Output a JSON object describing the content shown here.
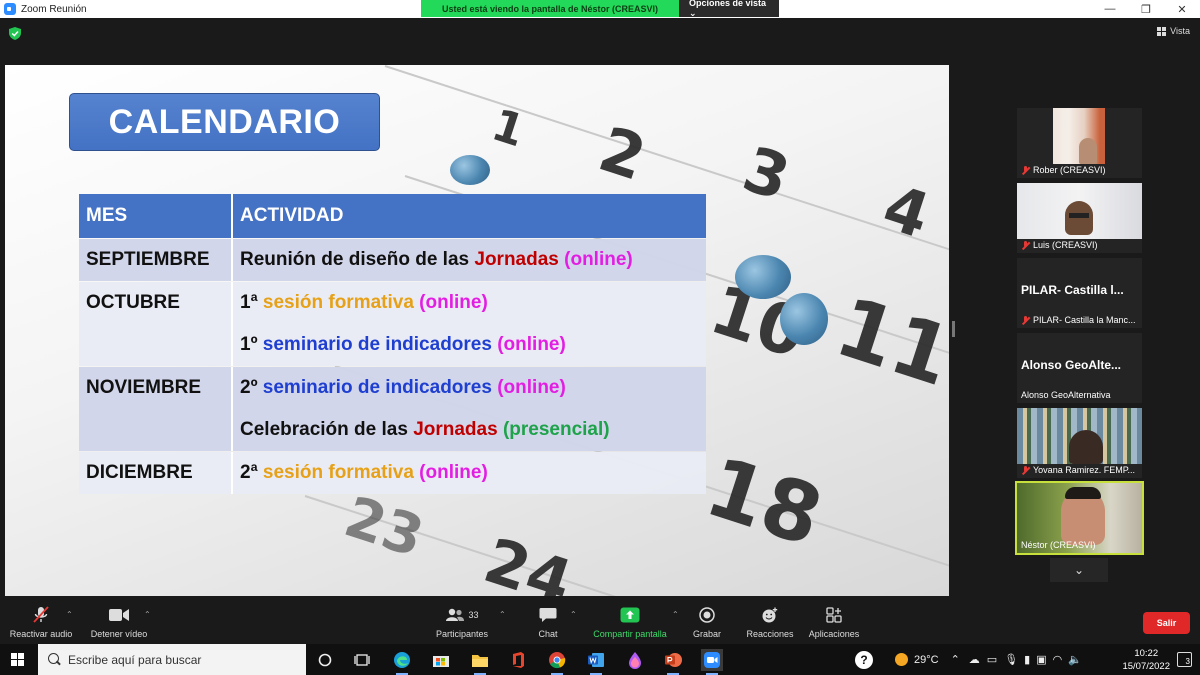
{
  "window": {
    "title": "Zoom Reunión",
    "minimize": "—",
    "maximize": "❐",
    "close": "✕"
  },
  "share_banner": {
    "notice": "Usted está viendo la pantalla de Néstor (CREASVI)",
    "view_options": "Opciones de vista ⌄"
  },
  "view_button": "Vista",
  "slide": {
    "title": "CALENDARIO",
    "background_numbers": [
      "1",
      "2",
      "3",
      "4",
      "10",
      "11",
      "18",
      "23",
      "24"
    ],
    "headers": [
      "MES",
      "ACTIVIDAD"
    ],
    "rows": [
      {
        "month": "SEPTIEMBRE",
        "activities": [
          [
            {
              "t": "Reunión de diseño de las ",
              "c": "k"
            },
            {
              "t": "Jornadas",
              "c": "red"
            },
            {
              "t": " (online)",
              "c": "mag"
            }
          ]
        ]
      },
      {
        "month": "OCTUBRE",
        "activities": [
          [
            {
              "t": "1ª ",
              "c": "k"
            },
            {
              "t": "sesión formativa",
              "c": "gold"
            },
            {
              "t": " (online)",
              "c": "mag"
            }
          ],
          [
            {
              "t": "1º ",
              "c": "k"
            },
            {
              "t": "seminario de indicadores",
              "c": "blue"
            },
            {
              "t": " (online)",
              "c": "mag"
            }
          ]
        ]
      },
      {
        "month": "NOVIEMBRE",
        "activities": [
          [
            {
              "t": "2º ",
              "c": "k"
            },
            {
              "t": "seminario de indicadores",
              "c": "blue"
            },
            {
              "t": " (online)",
              "c": "mag"
            }
          ],
          [
            {
              "t": "Celebración de las ",
              "c": "k"
            },
            {
              "t": "Jornadas",
              "c": "red"
            },
            {
              "t": " (presencial)",
              "c": "green"
            }
          ]
        ]
      },
      {
        "month": "DICIEMBRE",
        "activities": [
          [
            {
              "t": "2ª ",
              "c": "k"
            },
            {
              "t": "sesión formativa",
              "c": "gold"
            },
            {
              "t": " (online)",
              "c": "mag"
            }
          ]
        ]
      }
    ]
  },
  "participants": [
    {
      "name": "Rober (CREASVI)",
      "muted": true,
      "video": true,
      "display": ""
    },
    {
      "name": "Luis (CREASVI)",
      "muted": true,
      "video": true,
      "display": ""
    },
    {
      "name": "PILAR- Castilla la Manc...",
      "muted": true,
      "video": false,
      "display": "PILAR-  Castilla  l..."
    },
    {
      "name": "Alonso GeoAlternativa",
      "muted": false,
      "video": false,
      "display": "Alonso  GeoAlte..."
    },
    {
      "name": "Yovana Ramirez. FEMP...",
      "muted": true,
      "video": true,
      "display": ""
    },
    {
      "name": "Néstor (CREASVI)",
      "muted": false,
      "video": true,
      "display": "",
      "active": true
    }
  ],
  "toolbar": {
    "unmute": "Reactivar audio",
    "stop_video": "Detener vídeo",
    "participants": "Participantes",
    "participants_count": "33",
    "chat": "Chat",
    "share": "Compartir pantalla",
    "record": "Grabar",
    "reactions": "Reacciones",
    "apps": "Aplicaciones",
    "leave": "Salir"
  },
  "taskbar": {
    "search_placeholder": "Escribe aquí para buscar",
    "weather": "29°C",
    "time": "10:22",
    "date": "15/07/2022",
    "notifications": "3"
  }
}
